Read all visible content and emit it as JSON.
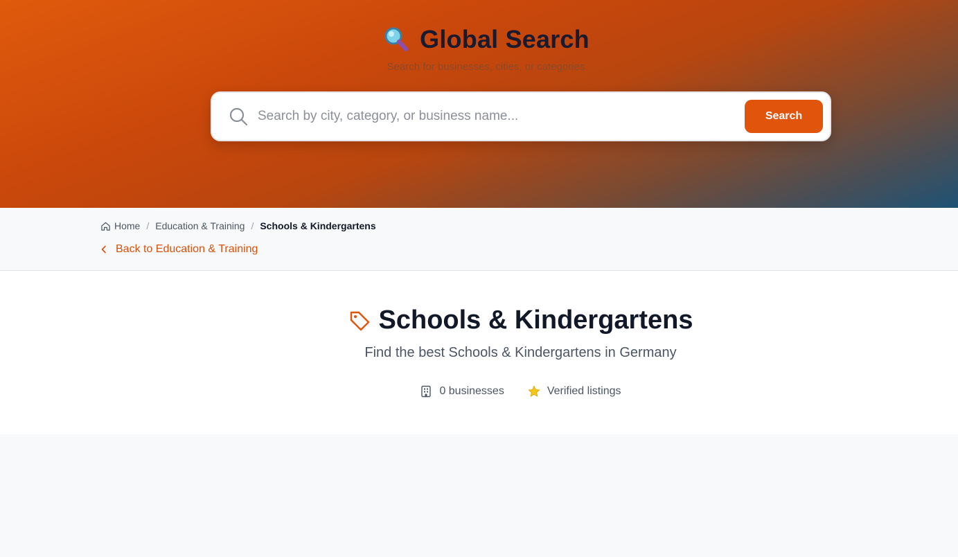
{
  "hero": {
    "title": "Global Search",
    "subtitle": "Search for businesses, cities, or categories",
    "icon": "magnifier-emoji-icon"
  },
  "search": {
    "placeholder": "Search by city, category, or business name...",
    "value": "",
    "button_label": "Search"
  },
  "breadcrumb": {
    "items": [
      "Home",
      "Education & Training",
      "Schools & Kindergartens"
    ],
    "separator": "/"
  },
  "back_link": {
    "label": "Back to Education & Training"
  },
  "category": {
    "title": "Schools & Kindergartens",
    "subtitle": "Find the best Schools & Kindergartens in Germany",
    "stats": {
      "businesses": "0 businesses",
      "verified": "Verified listings"
    }
  },
  "colors": {
    "accent": "#e0540c",
    "title": "#111827",
    "muted": "#4b5563"
  }
}
